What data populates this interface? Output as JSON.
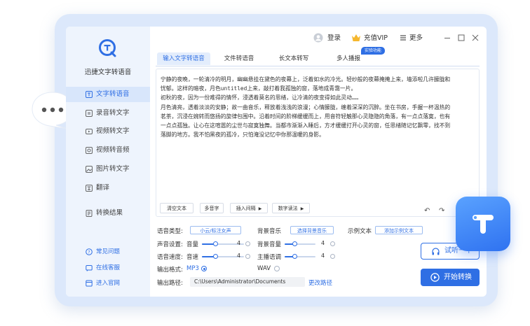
{
  "app": {
    "name": "迅捷文字转语音"
  },
  "sidebar": {
    "items": [
      {
        "label": "文字转语音",
        "icon": "text-to-speech-icon",
        "active": true
      },
      {
        "label": "录音转文字",
        "icon": "recording-to-text-icon",
        "active": false
      },
      {
        "label": "视频转文字",
        "icon": "video-to-text-icon",
        "active": false
      },
      {
        "label": "视频转音频",
        "icon": "video-to-audio-icon",
        "active": false
      },
      {
        "label": "图片转文字",
        "icon": "image-to-text-icon",
        "active": false
      },
      {
        "label": "翻译",
        "icon": "translate-icon",
        "active": false
      },
      {
        "label": "转换结果",
        "icon": "result-icon",
        "active": false
      }
    ],
    "help": [
      {
        "label": "常见问题",
        "icon": "question-icon"
      },
      {
        "label": "在线客服",
        "icon": "customer-service-icon"
      },
      {
        "label": "进入官网",
        "icon": "website-icon"
      }
    ]
  },
  "topbar": {
    "login": "登录",
    "vip": "充值VIP",
    "more": "更多"
  },
  "tabs": [
    {
      "label": "输入文字转语音",
      "active": true
    },
    {
      "label": "文件转语音",
      "active": false
    },
    {
      "label": "长文本转写",
      "active": false
    },
    {
      "label": "多人播报",
      "active": false
    }
  ],
  "tab_badge": "实验功能",
  "editor": {
    "text": "宁静的夜晚，一轮清冷的明月，幽幽悬挂在黛色的夜幕上，泛着如水的冷光。轻纱般的夜幕掩掩上来，墙添啦几许朦胧和\n忧郁。这样的暗夜，月色untitled上来，敲打着我孤独的窗，落地成青霭一片。\n初秋的夜，因为一份难得的情怀，浸透着莫名的思绪，让冷清的夜变得如此灵动……\n月色清亮，透着淡淡的安静；故一曲音乐，释放着浅浅的浪漫；心情朦胧，缠着深深的沉醉。坐在书房，手握一杯温热的\n茗茶，沉浸在婉转而悠扬的旋律包围中。沿着时间的阶梯缓缓而上，用音符轻触那心灵隐隐的角落，有一点点落寞，也有\n一点点孤独。让心在这喧嚣的尘世与寂寞独舞。当都市渐渐入睡后，方才缓缓打开心灵的窗，任思绪随记忆飘零，找不到\n落脚的地方。我不怕黑夜的孤冷，只怕淹没记忆中你那温暖的身影。",
    "buttons": {
      "clear": "清空文本",
      "polyphone": "多音字",
      "insert_pause": "插入间隔",
      "number_read": "数字读法"
    }
  },
  "settings": {
    "voice_type_label": "语音类型:",
    "voice_type_value": "小云/标注女声",
    "bg_music_label": "背景音乐",
    "bg_music_value": "选择背景音乐",
    "sample_label": "示例文本",
    "sample_value": "添加示例文本",
    "sound_label": "声音设置:",
    "volume_label": "音量",
    "volume_value": "4",
    "volume_level": 0.32,
    "bg_volume_label": "背景音量",
    "bg_volume_value": "4",
    "bg_volume_level": 0.32,
    "speed_label": "语音速度:",
    "speed_sub_label": "音速",
    "speed_value": "4",
    "speed_level": 0.32,
    "pitch_label": "主播语调",
    "pitch_value": "4",
    "pitch_level": 0.32,
    "format_label": "输出格式:",
    "format_mp3": "MP3",
    "format_wav": "WAV",
    "path_label": "输出路径:",
    "path_value": "C:\\Users\\Administrator\\Documents",
    "change_path": "更改路径"
  },
  "actions": {
    "listen": "试听一下",
    "convert": "开始转换"
  },
  "colors": {
    "accent": "#2f6fe4",
    "sidebar_bg": "#eef4fd",
    "frame_bg": "#dce8fb"
  }
}
